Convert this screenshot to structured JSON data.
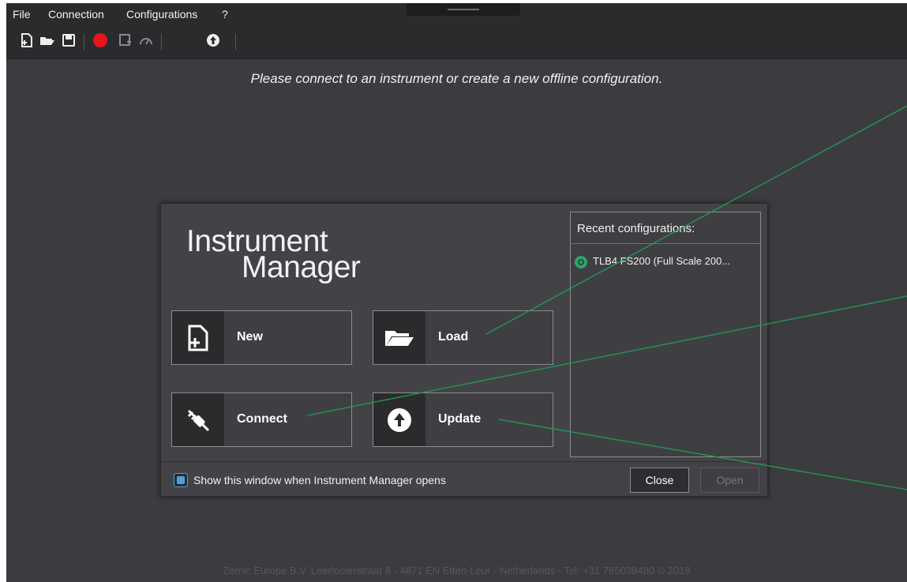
{
  "menu": {
    "items": [
      {
        "label": "File"
      },
      {
        "label": "Connection"
      },
      {
        "label": "Configurations"
      },
      {
        "label": "?"
      }
    ]
  },
  "toolbar": {
    "icons": [
      "new-file-icon",
      "open-folder-icon",
      "save-icon",
      "record-icon",
      "save-as-icon",
      "gauge-icon",
      "update-icon"
    ]
  },
  "main": {
    "prompt": "Please connect to an instrument or create a new offline configuration."
  },
  "dialog": {
    "logo_line1": "Instrument",
    "logo_line2": "Manager",
    "buttons": {
      "new": "New",
      "load": "Load",
      "connect": "Connect",
      "update": "Update"
    },
    "recent": {
      "title": "Recent configurations:",
      "items": [
        {
          "label": "TLB4 FS200 (Full Scale 200..."
        }
      ]
    },
    "show_on_open": {
      "label": "Show this window when Instrument Manager opens",
      "checked": true
    },
    "close_label": "Close",
    "open_label": "Open"
  },
  "footer": {
    "text": "Zemic Europe B.V. Leerlooierstraat 8 - 4871 EN Etten-Leur - Netherlands - Tel: +31 765039480        © 2018"
  },
  "colors": {
    "background": "#3c3c40",
    "menubar": "#2b2b2e",
    "record": "#e8141c",
    "accent_blue": "#4a9fe0",
    "recent_green": "#2aa869",
    "annotation_line": "#1f9e54"
  }
}
